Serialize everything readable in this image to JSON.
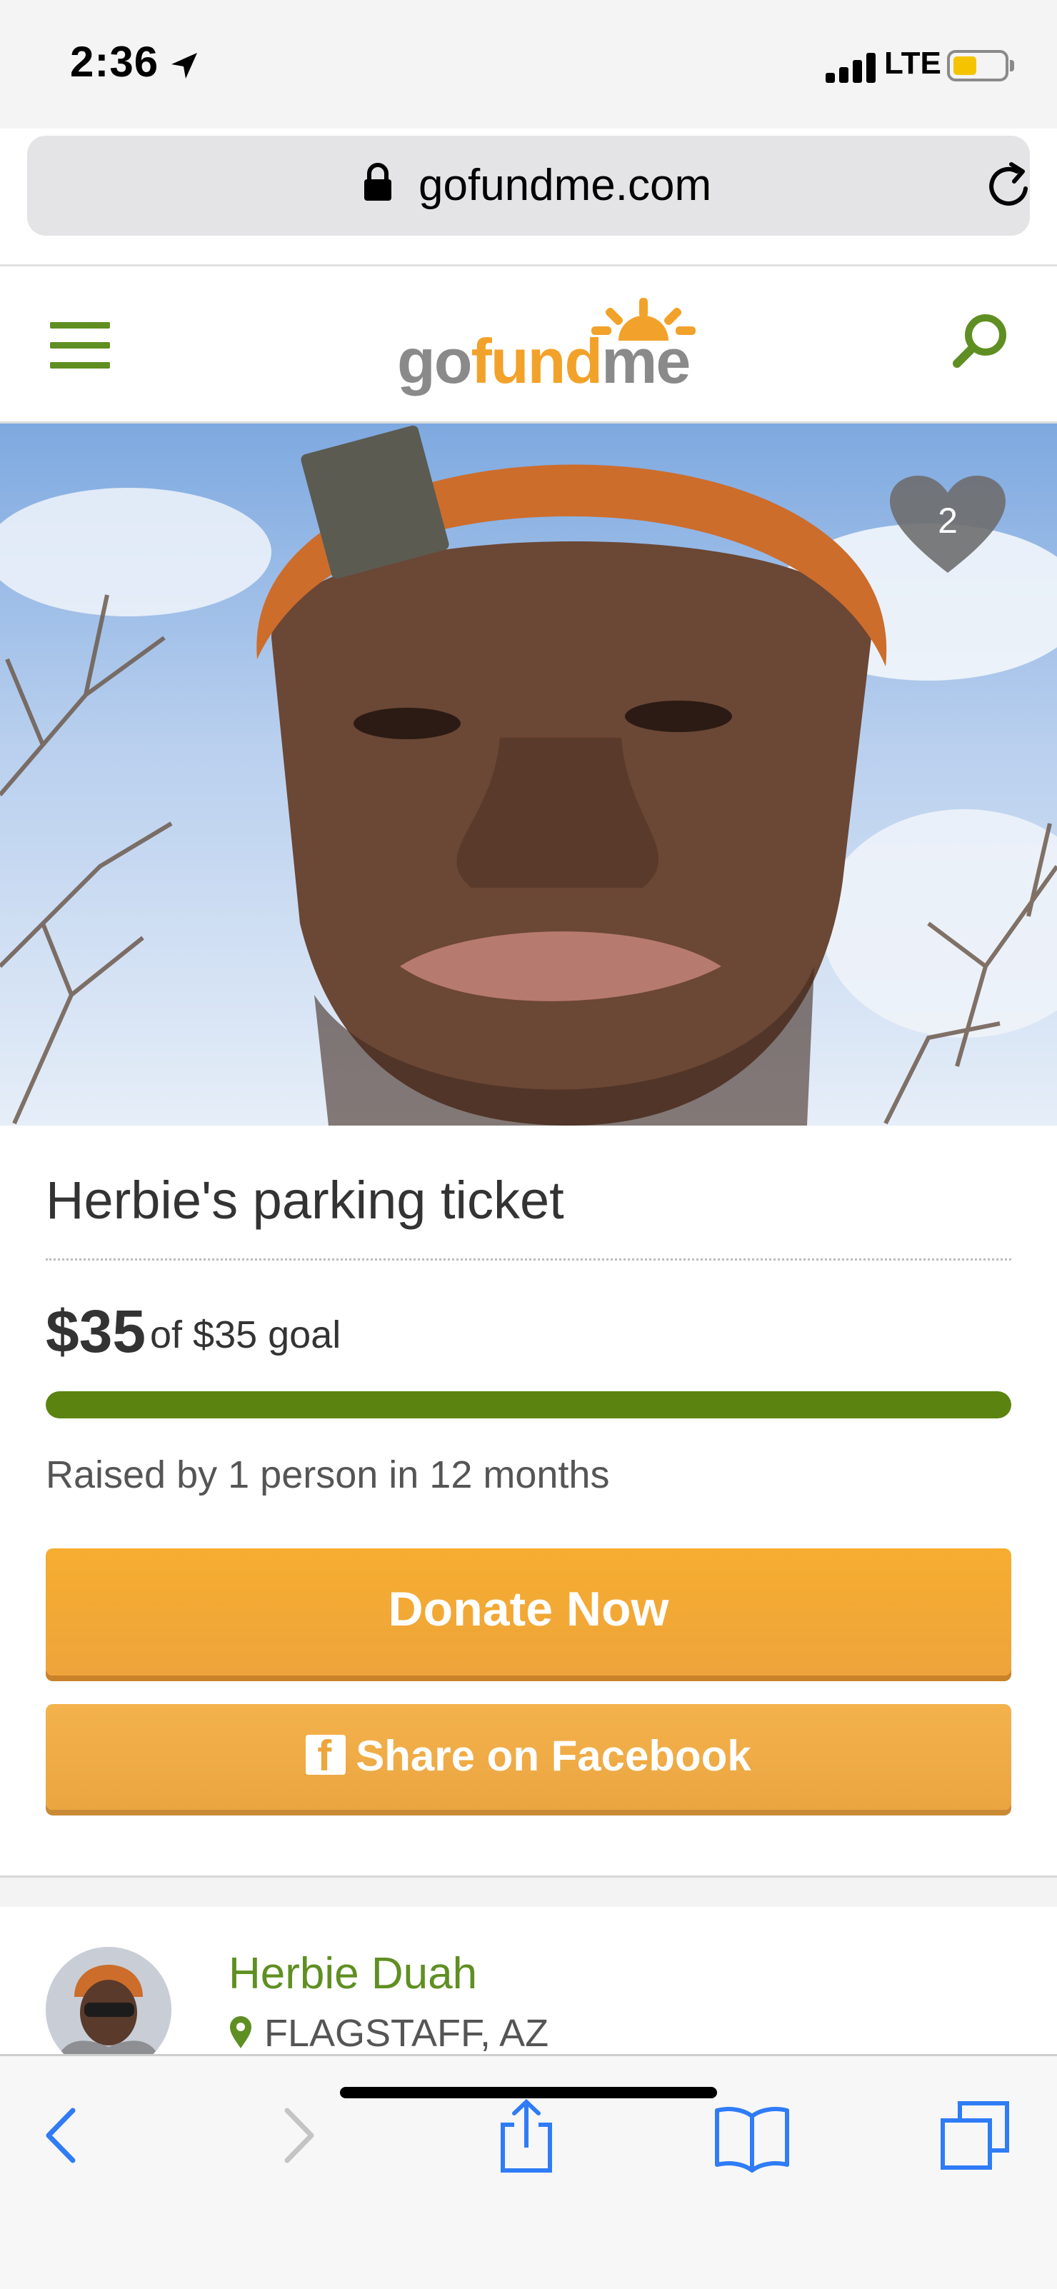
{
  "status_bar": {
    "time": "2:36",
    "network": "LTE",
    "icons": [
      "location-arrow-icon",
      "signal-icon",
      "battery-icon"
    ]
  },
  "browser": {
    "url": "gofundme.com",
    "icons": [
      "lock-icon",
      "reload-icon"
    ]
  },
  "site_header": {
    "logo": {
      "part1": "go",
      "part2": "fund",
      "part3": "me"
    },
    "icons": [
      "hamburger-menu-icon",
      "search-icon"
    ],
    "colors": {
      "brand_green": "#5f8f22",
      "brand_orange": "#f2a22a"
    }
  },
  "hero": {
    "favorites_count": "2"
  },
  "campaign": {
    "title": "Herbie's parking ticket",
    "raised": "$35",
    "goal_text": "of $35 goal",
    "progress_percent": 100,
    "raised_by": "Raised by 1 person in 12 months",
    "donate_label": "Donate Now",
    "share_label": "Share on Facebook",
    "colors": {
      "progress": "#5b8310",
      "button": "#f0a73a"
    }
  },
  "organizer": {
    "name": "Herbie Duah",
    "location": "FLAGSTAFF, AZ"
  },
  "toolbar": {
    "icons": [
      "back-icon",
      "forward-icon",
      "share-icon",
      "bookmarks-icon",
      "tabs-icon"
    ]
  }
}
